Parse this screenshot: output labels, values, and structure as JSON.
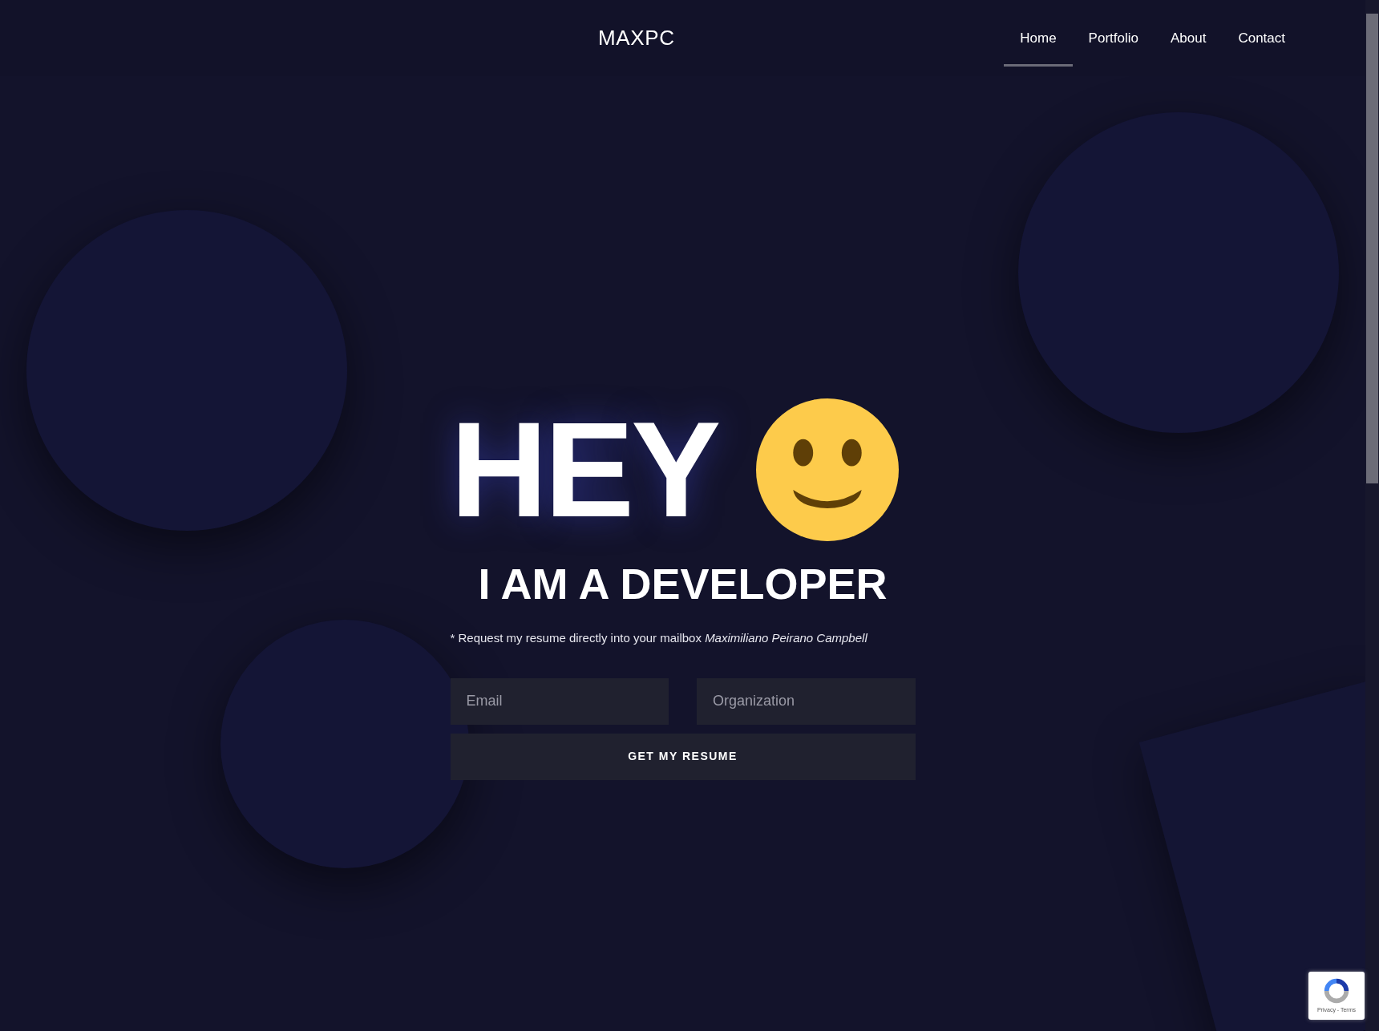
{
  "header": {
    "brand": "MAXPC",
    "nav": [
      {
        "label": "Home",
        "selected": true
      },
      {
        "label": "Portfolio",
        "selected": false
      },
      {
        "label": "About",
        "selected": false
      },
      {
        "label": "Contact",
        "selected": false
      }
    ]
  },
  "hero": {
    "title": "HEY",
    "subtitle": "I AM A DEVELOPER",
    "note": "* Request my resume directly into your mailbox *Maximiliano Peirano Campbell*"
  },
  "form": {
    "fields": [
      {
        "placeholder": "Email"
      },
      {
        "placeholder": "Organization"
      }
    ],
    "button": "GET MY RESUME"
  },
  "recaptcha": {
    "links": "Privacy - Terms"
  }
}
